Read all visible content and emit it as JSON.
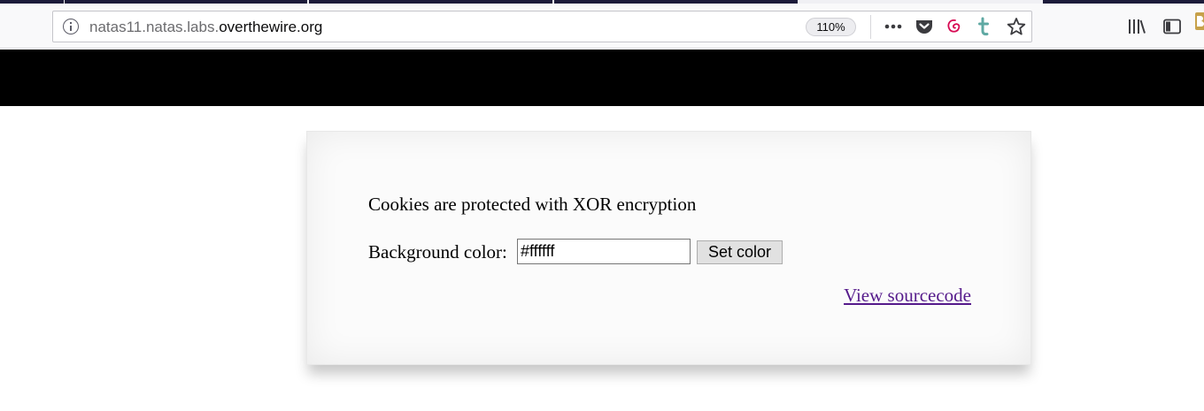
{
  "browser": {
    "url": {
      "prefix": "natas11.natas.labs.",
      "domain": "overthewire.org"
    },
    "zoom_level": "110%",
    "toolbar_icons": [
      "info-icon",
      "page-actions-icon",
      "pocket-icon",
      "debian-icon",
      "tumblr-icon",
      "bookmark-star-icon",
      "library-icon",
      "sidebar-icon",
      "extension-icon"
    ],
    "colors": {
      "header_band": "#000000",
      "tab_strip": "#1c1b3a",
      "link_visited": "#551a8b"
    }
  },
  "page": {
    "intro_text": "Cookies are protected with XOR encryption",
    "color_form": {
      "label": "Background color:",
      "value": "#ffffff",
      "submit_label": "Set color"
    },
    "source_link": "View sourcecode"
  }
}
